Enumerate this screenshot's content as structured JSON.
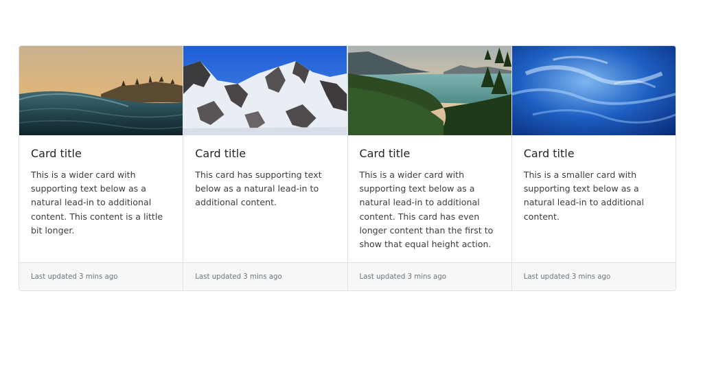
{
  "cards": [
    {
      "image": "ocean-wave-sunset-image",
      "title": "Card title",
      "text": "This is a wider card with supporting text below as a natural lead-in to additional content. This content is a little bit longer.",
      "footer": "Last updated 3 mins ago"
    },
    {
      "image": "snowy-mountain-image",
      "title": "Card title",
      "text": "This card has supporting text below as a natural lead-in to additional content.",
      "footer": "Last updated 3 mins ago"
    },
    {
      "image": "mountain-lake-image",
      "title": "Card title",
      "text": "This is a wider card with supporting text below as a natural lead-in to additional content. This card has even longer content than the first to show that equal height action.",
      "footer": "Last updated 3 mins ago"
    },
    {
      "image": "blue-water-image",
      "title": "Card title",
      "text": "This is a smaller card with supporting text below as a natural lead-in to additional content.",
      "footer": "Last updated 3 mins ago"
    }
  ],
  "colors": {
    "border": "#dfe1e4",
    "footer_bg": "#f7f7f7",
    "muted_text": "#6c757d"
  }
}
